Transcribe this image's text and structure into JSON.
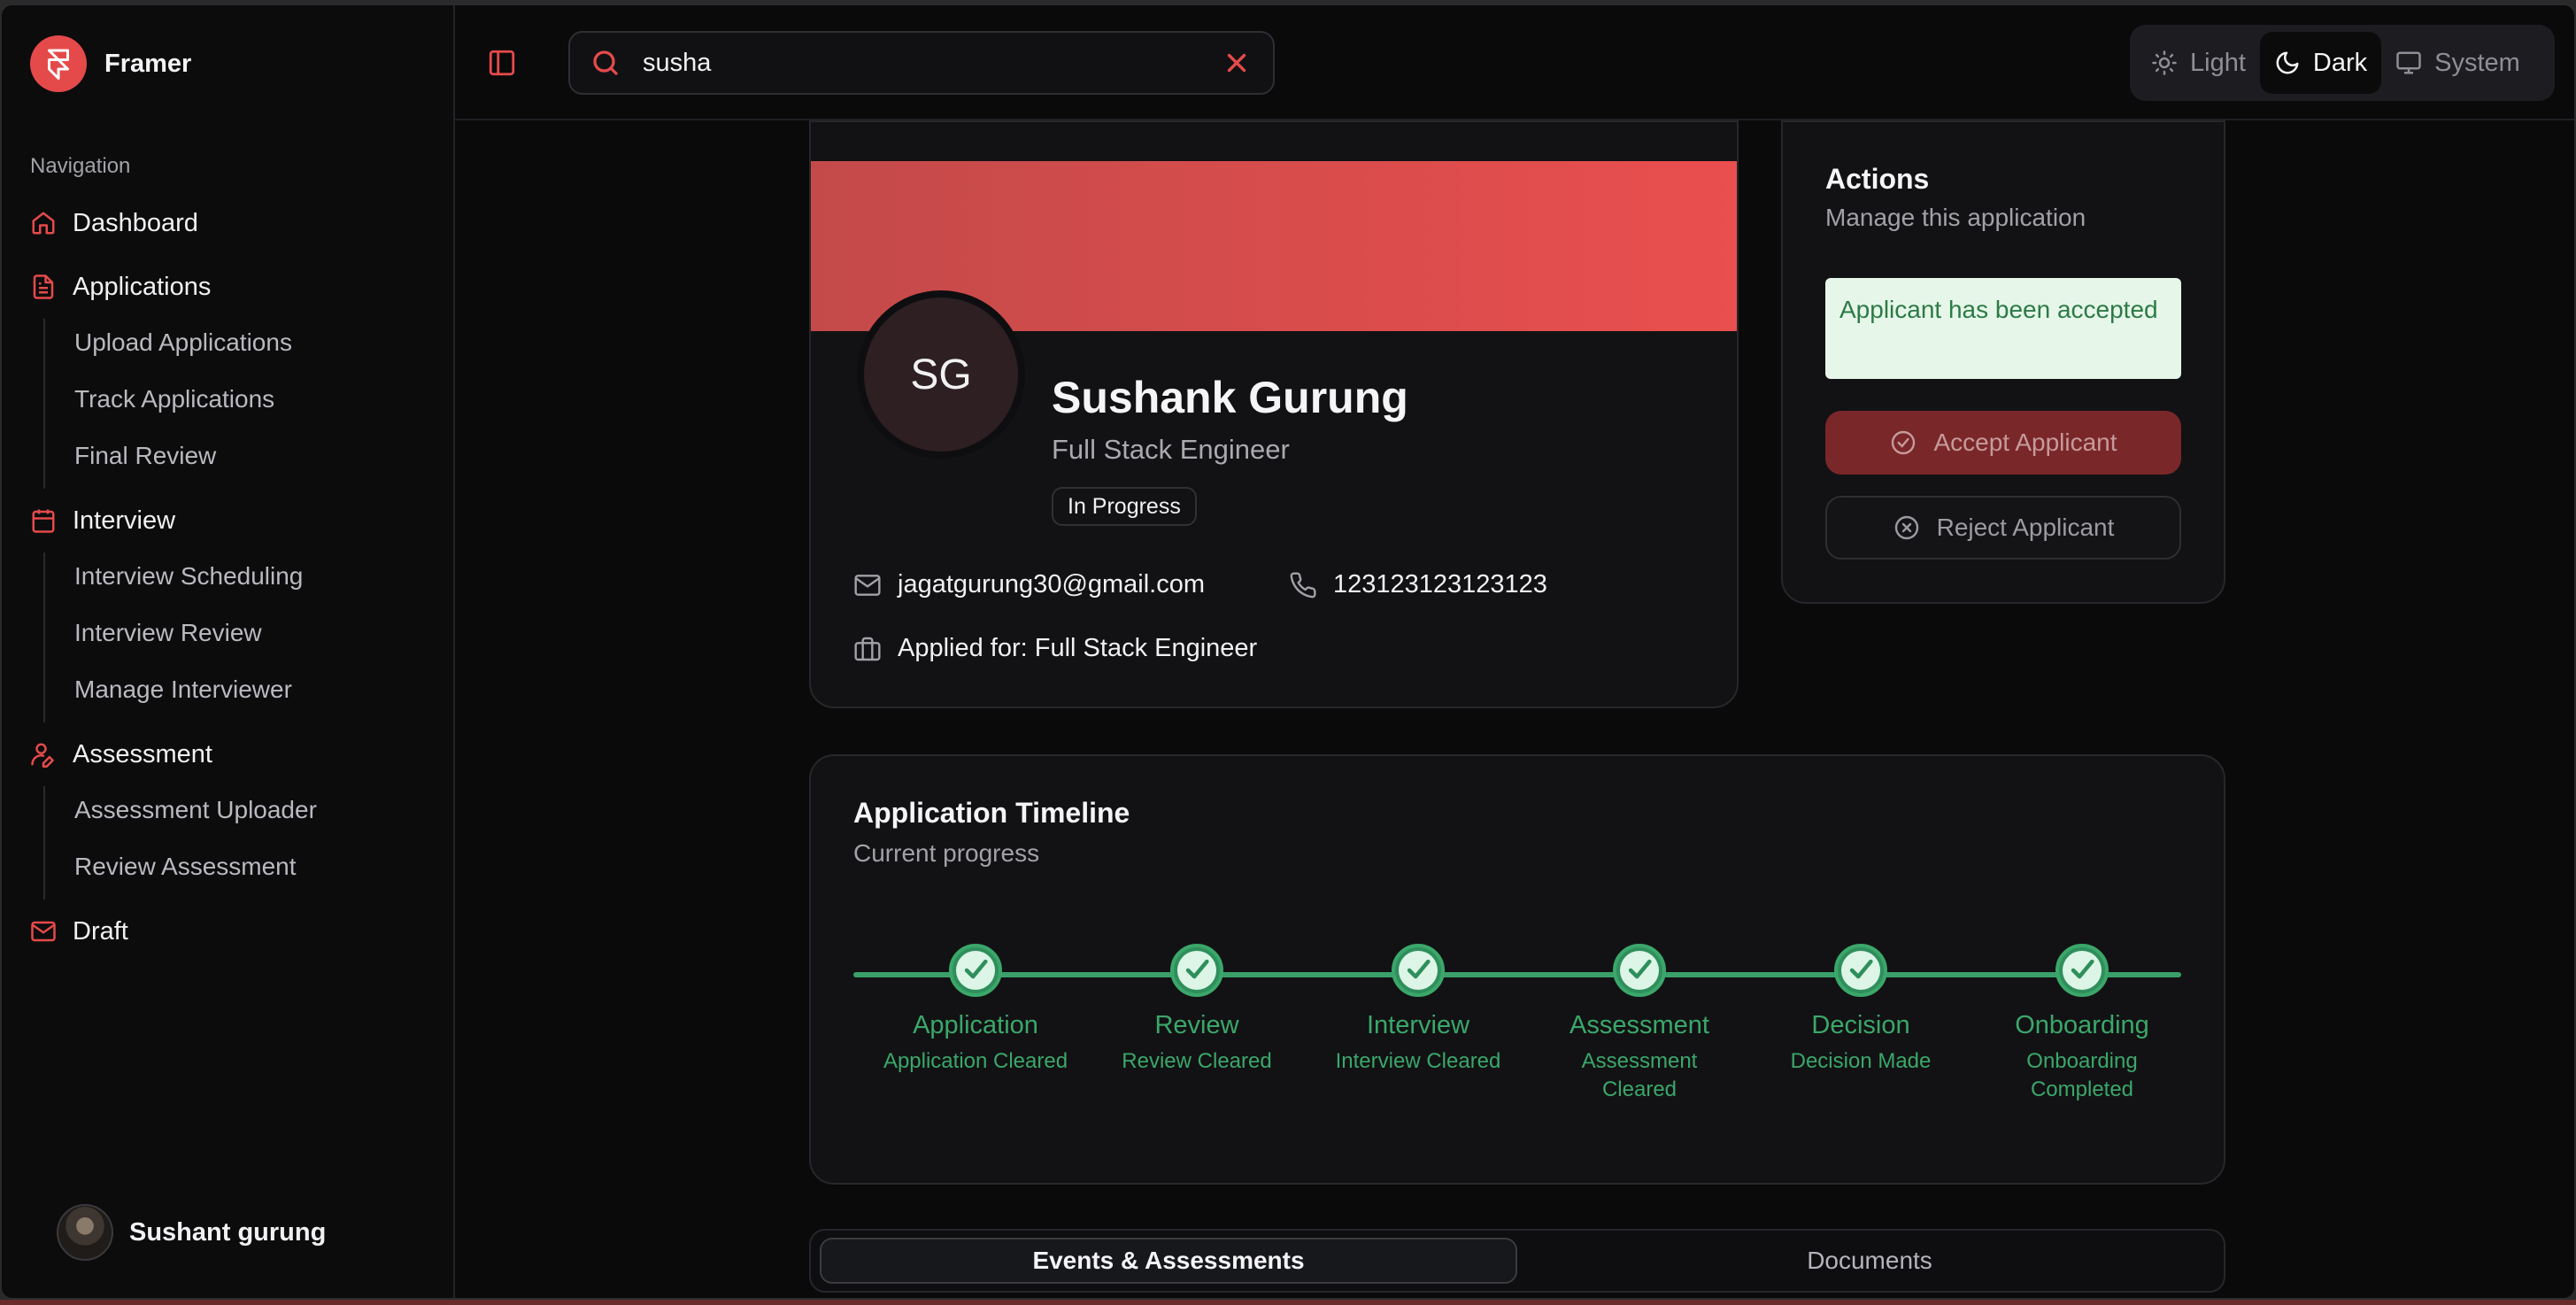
{
  "brand": {
    "name": "Framer"
  },
  "sidebar": {
    "heading": "Navigation",
    "items": [
      {
        "label": "Dashboard",
        "icon": "home-icon"
      },
      {
        "label": "Applications",
        "icon": "document-icon",
        "children": [
          "Upload Applications",
          "Track Applications",
          "Final Review"
        ]
      },
      {
        "label": "Interview",
        "icon": "calendar-icon",
        "children": [
          "Interview Scheduling",
          "Interview Review",
          "Manage Interviewer"
        ]
      },
      {
        "label": "Assessment",
        "icon": "user-pen-icon",
        "children": [
          "Assessment Uploader",
          "Review Assessment"
        ]
      },
      {
        "label": "Draft",
        "icon": "mail-icon"
      }
    ],
    "user": {
      "name": "Sushant gurung"
    }
  },
  "search": {
    "value": "susha"
  },
  "theme": {
    "options": [
      "Light",
      "Dark",
      "System"
    ],
    "selected": "Dark"
  },
  "profile": {
    "initials": "SG",
    "name": "Sushank Gurung",
    "role": "Full Stack Engineer",
    "status": "In Progress",
    "email": "jagatgurung30@gmail.com",
    "phone": "123123123123123",
    "applied_for": "Applied for: Full Stack Engineer"
  },
  "actions": {
    "title": "Actions",
    "subtitle": "Manage this application",
    "notice": "Applicant has been accepted",
    "accept_label": "Accept Applicant",
    "reject_label": "Reject Applicant"
  },
  "timeline": {
    "title": "Application Timeline",
    "subtitle": "Current progress",
    "steps": [
      {
        "label": "Application",
        "desc": "Application Cleared"
      },
      {
        "label": "Review",
        "desc": "Review Cleared"
      },
      {
        "label": "Interview",
        "desc": "Interview Cleared"
      },
      {
        "label": "Assessment",
        "desc": "Assessment Cleared"
      },
      {
        "label": "Decision",
        "desc": "Decision Made"
      },
      {
        "label": "Onboarding",
        "desc": "Onboarding Completed"
      }
    ]
  },
  "tabs": [
    {
      "label": "Events & Assessments",
      "active": true
    },
    {
      "label": "Documents",
      "active": false
    }
  ],
  "colors": {
    "accent": "#e54a4a",
    "success": "#3ba76a",
    "background": "#0a0a0b"
  }
}
